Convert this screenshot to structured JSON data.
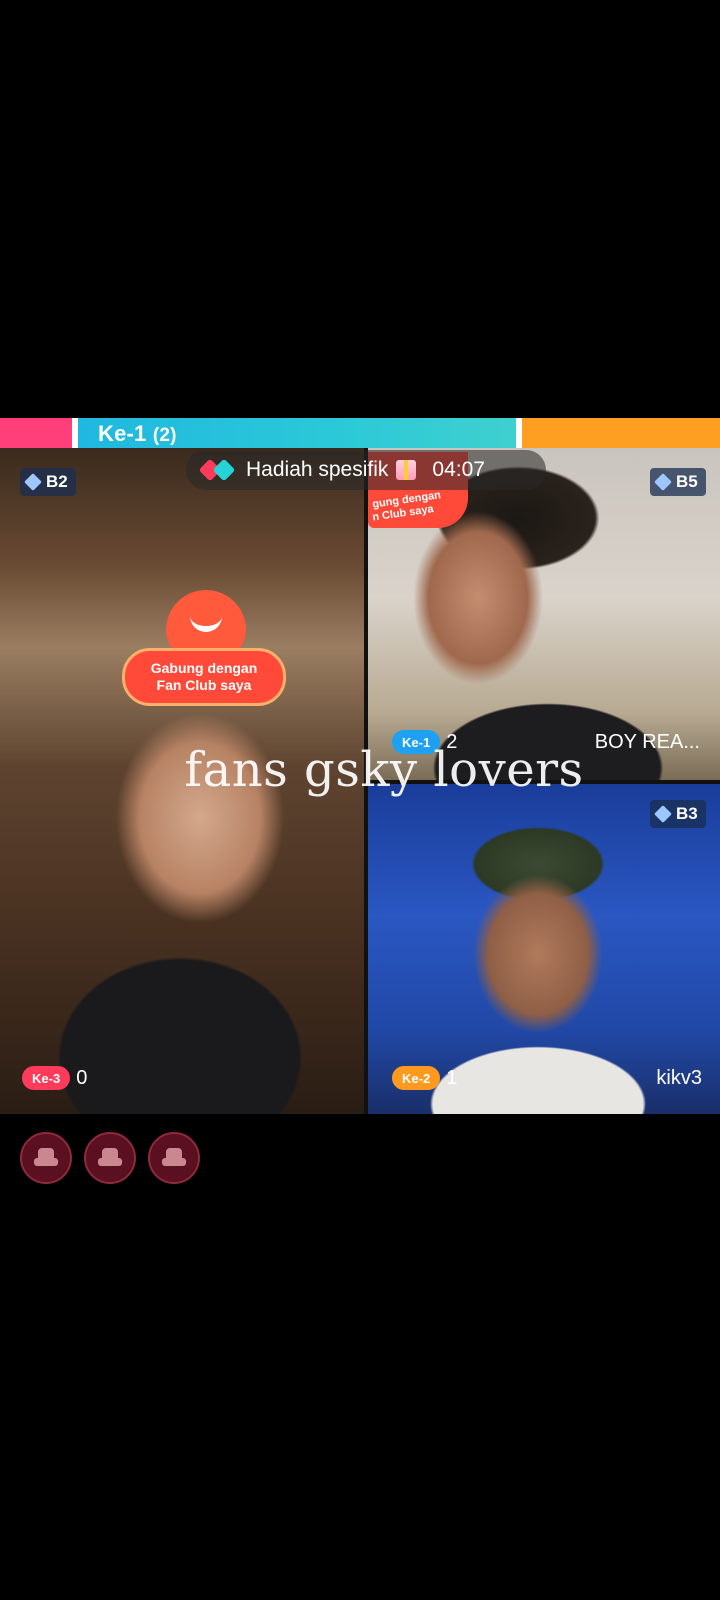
{
  "score_bar": {
    "label": "Ke-1",
    "count": "(2)",
    "colors": {
      "left": "#ff3f7a",
      "middle": "#20b8e0",
      "right": "#ff9f22"
    }
  },
  "gift_banner": {
    "text": "Hadiah spesifik",
    "timer": "04:07"
  },
  "participants": [
    {
      "rank": "B2",
      "position_label": "Ke-3",
      "score": "0",
      "name": ""
    },
    {
      "rank": "B5",
      "position_label": "Ke-1",
      "score": "2",
      "name": "BOY REA..."
    },
    {
      "rank": "B3",
      "position_label": "Ke-2",
      "score": "1",
      "name": "kikv3"
    }
  ],
  "sticker": {
    "line1": "Gabung dengan",
    "line2": "Fan Club saya",
    "small_line1": "gung dengan",
    "small_line2": "n Club saya"
  },
  "overlay_text": "fans gsky lovers",
  "seats": [
    {
      "icon": "seat-icon"
    },
    {
      "icon": "seat-icon"
    },
    {
      "icon": "seat-icon"
    }
  ]
}
